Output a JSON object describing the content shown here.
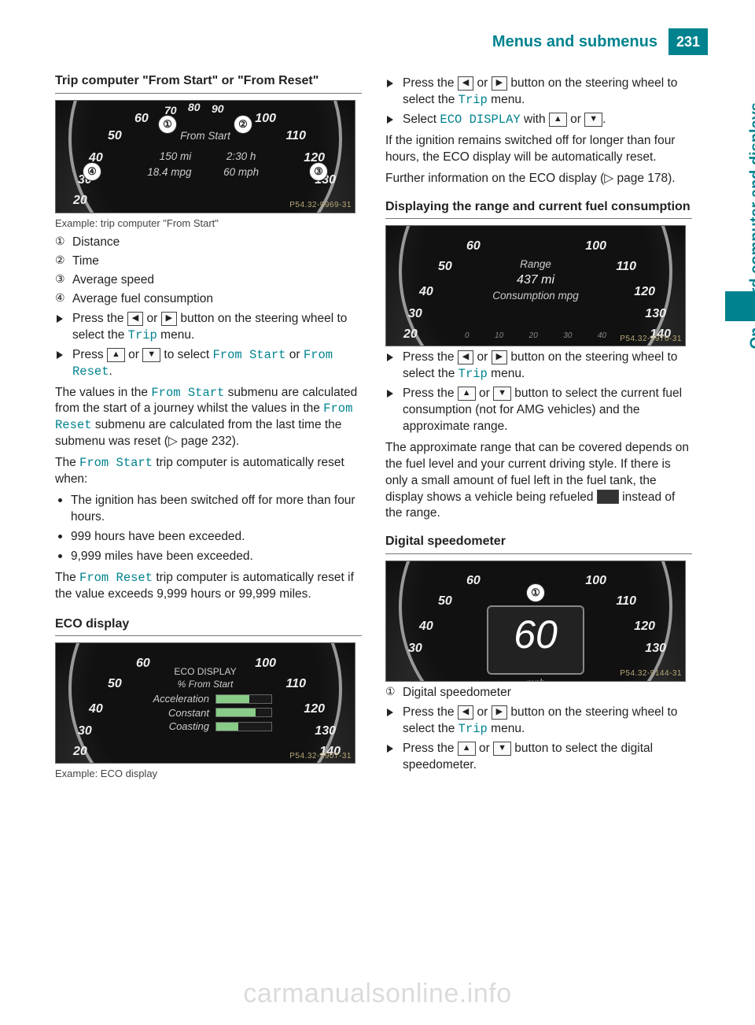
{
  "header": {
    "title": "Menus and submenus",
    "page": "231"
  },
  "sidebar": "On-board computer and displays",
  "col1": {
    "h1": "Trip computer \"From Start\" or \"From Reset\"",
    "fig1": {
      "code": "P54.32-9969-31",
      "top_label": "From Start",
      "v1": "150 mi",
      "v2": "2:30 h",
      "v3": "18.4 mpg",
      "v4": "60 mph"
    },
    "caption1": "Example: trip computer \"From Start\"",
    "leg1": "Distance",
    "leg2": "Time",
    "leg3": "Average speed",
    "leg4": "Average fuel consumption",
    "s1a": "Press the ",
    "s1b": " or ",
    "s1c": " button on the steering wheel to select the ",
    "s1d": "Trip",
    "s1e": " menu.",
    "s2a": "Press ",
    "s2b": " or ",
    "s2c": " to select ",
    "s2d": "From Start",
    "s2e": " or ",
    "s2f": "From Reset",
    "s2g": ".",
    "p1a": "The values in the ",
    "p1b": "From Start",
    "p1c": " submenu are calculated from the start of a journey whilst the values in the ",
    "p1d": "From Reset",
    "p1e": " submenu are calculated from the last time the submenu was reset (▷ page 232).",
    "p2a": "The ",
    "p2b": "From Start",
    "p2c": " trip computer is automatically reset when:",
    "b1": "The ignition has been switched off for more than four hours.",
    "b2": "999 hours have been exceeded.",
    "b3": "9,999 miles have been exceeded.",
    "p3a": "The ",
    "p3b": "From Reset",
    "p3c": " trip computer is automatically reset if the value exceeds 9,999 hours or 99,999 miles.",
    "h2": "ECO display",
    "fig2": {
      "code": "P54.32-9907-31",
      "t1": "ECO DISPLAY",
      "t2": "% From Start",
      "r1": "Acceleration",
      "r2": "Constant",
      "r3": "Coasting"
    },
    "caption2": "Example: ECO display"
  },
  "col2": {
    "s3a": "Press the ",
    "s3b": " or ",
    "s3c": " button on the steering wheel to select the ",
    "s3d": "Trip",
    "s3e": " menu.",
    "s4a": "Select ",
    "s4b": "ECO DISPLAY",
    "s4c": " with ",
    "s4d": " or ",
    "s4e": ".",
    "p4": "If the ignition remains switched off for longer than four hours, the ECO display will be automatically reset.",
    "p5": "Further information on the ECO display (▷ page 178).",
    "h3": "Displaying the range and current fuel consumption",
    "fig3": {
      "code": "P54.32-9970-31",
      "t1": "Range",
      "t2": "437 mi",
      "t3": "Consumption mpg"
    },
    "ticks": [
      "0",
      "10",
      "20",
      "30",
      "40"
    ],
    "s5a": "Press the ",
    "s5b": " or ",
    "s5c": " button on the steering wheel to select the ",
    "s5d": "Trip",
    "s5e": " menu.",
    "s6a": "Press the ",
    "s6b": " or ",
    "s6c": " button to select the current fuel consumption (not for AMG vehicles) and the approximate range.",
    "p6a": "The approximate range that can be covered depends on the fuel level and your current driving style. If there is only a small amount of fuel left in the fuel tank, the display shows a vehicle being refueled ",
    "p6b": " instead of the range.",
    "h4": "Digital speedometer",
    "fig4": {
      "code": "P54.32-9144-31",
      "speed": "60",
      "unit": "mph"
    },
    "leg_ds": "Digital speedometer",
    "s7a": "Press the ",
    "s7b": " or ",
    "s7c": " button on the steering wheel to select the ",
    "s7d": "Trip",
    "s7e": " menu.",
    "s8a": "Press the ",
    "s8b": " or ",
    "s8c": " button to select the digital speedometer."
  },
  "gauge_nums": {
    "n20": "20",
    "n30": "30",
    "n40": "40",
    "n50": "50",
    "n60": "60",
    "n70": "70",
    "n80": "80",
    "n90": "90",
    "n100": "100",
    "n110": "110",
    "n120": "120",
    "n130": "130",
    "n140": "140"
  },
  "watermark": "carmanualsonline.info",
  "chart_data": {
    "type": "table",
    "title": "Trip computer \"From Start\" example readout",
    "categories": [
      "Distance (mi)",
      "Time (h)",
      "Average speed (mph)",
      "Average fuel consumption (mpg)"
    ],
    "values": [
      150,
      2.5,
      60,
      18.4
    ]
  }
}
